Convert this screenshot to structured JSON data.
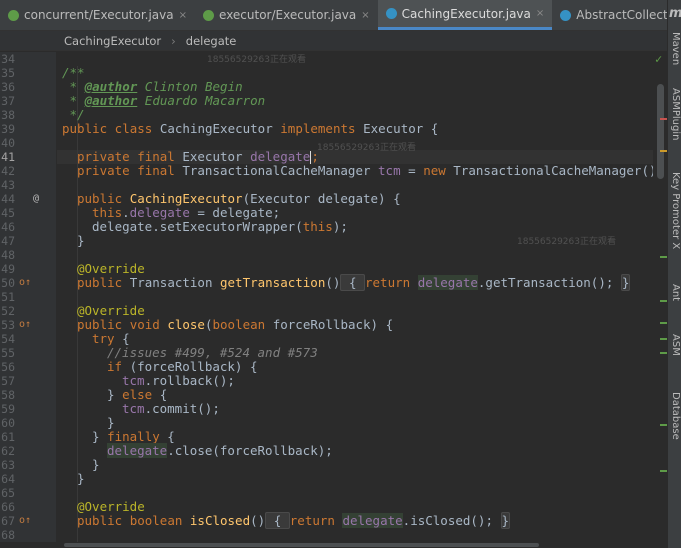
{
  "tabs": [
    {
      "label": "concurrent/Executor.java",
      "icon": "interface-icon",
      "close": "×",
      "active": false
    },
    {
      "label": "executor/Executor.java",
      "icon": "interface-icon",
      "close": "×",
      "active": false
    },
    {
      "label": "CachingExecutor.java",
      "icon": "class-icon",
      "close": "×",
      "active": true
    },
    {
      "label": "AbstractCollection.java",
      "icon": "class-icon",
      "close": "×",
      "active": false
    }
  ],
  "tab_overflow": "≡",
  "breadcrumb": {
    "class_name": "CachingExecutor",
    "separator": "›",
    "member": "delegate"
  },
  "line_numbers": [
    "34",
    "35",
    "36",
    "37",
    "38",
    "39",
    "40",
    "41",
    "42",
    "43",
    "44",
    "45",
    "46",
    "47",
    "48",
    "49",
    "50",
    "51",
    "52",
    "53",
    "54",
    "55",
    "56",
    "57",
    "58",
    "59",
    "60",
    "61",
    "62",
    "63",
    "64",
    "65",
    "66",
    "67",
    "68",
    "69",
    "70"
  ],
  "gutter_marks": {
    "at": "@",
    "override": "o↑"
  },
  "code": {
    "doc_open": "/**",
    "doc_star": " * ",
    "author_tag": "@author",
    "author1": " Clinton Begin",
    "author2": " Eduardo Macarron",
    "doc_close": " */",
    "l39_kw": "public class ",
    "l39_name": "CachingExecutor ",
    "l39_impl": "implements ",
    "l39_iface": "Executor {",
    "l41_kw": "private final ",
    "l41_type": "Executor ",
    "l41_field": "delegate",
    "semi": ";",
    "l42_type": "TransactionalCacheManager ",
    "l42_field": "tcm",
    "l42_eq": " = ",
    "kw_new": "new ",
    "l42_ctor": "TransactionalCacheManager();",
    "kw_public": "public ",
    "l44_fn": "CachingExecutor",
    "l44_args": "(Executor delegate) {",
    "kw_this": "this",
    "dot": ".",
    "l45_rest": " = delegate;",
    "l46_text": "delegate.setExecutorWrapper(",
    "l46_tail": ");",
    "brace_close": "}",
    "override": "@Override",
    "l50_type": "Transaction ",
    "l50_fn": "getTransaction",
    "parens": "()",
    "fold_open": " { ",
    "kw_return": "return ",
    "l50_call": ".getTransaction(); ",
    "fold_close": "}",
    "kw_void": "void ",
    "l55_fn": "close",
    "l55_open": "(",
    "kw_boolean": "boolean ",
    "l55_param": "forceRollback) {",
    "kw_try": "try ",
    "brace_open": "{",
    "comment": "//issues #499, #524 and #573",
    "kw_if": "if ",
    "l58_cond": "(forceRollback) ",
    "l59_call": "rollback();",
    "kw_else": "else ",
    "l61_call": "commit();",
    "kw_finally": "finally ",
    "l64_call": ".close(forceRollback);",
    "l69_fn": "isClosed",
    "l69_call": ".isClosed(); "
  },
  "watermarks": [
    "18556529263正在观看",
    "18556529263正在观看",
    "18556529263正在观看"
  ],
  "right_tools": {
    "maven_logo": "m",
    "maven": "Maven",
    "asm_plugin": "ASMPlugin",
    "key_promoter": "Key Promoter X",
    "ant": "Ant",
    "asm": "ASM",
    "database": "Database"
  },
  "inspection_status": "✓",
  "colors": {
    "background": "#2b2b2b",
    "keyword": "#cc7832",
    "field": "#9876aa",
    "method": "#ffc66d",
    "annotation": "#bbb529",
    "accent": "#4a88c7"
  }
}
